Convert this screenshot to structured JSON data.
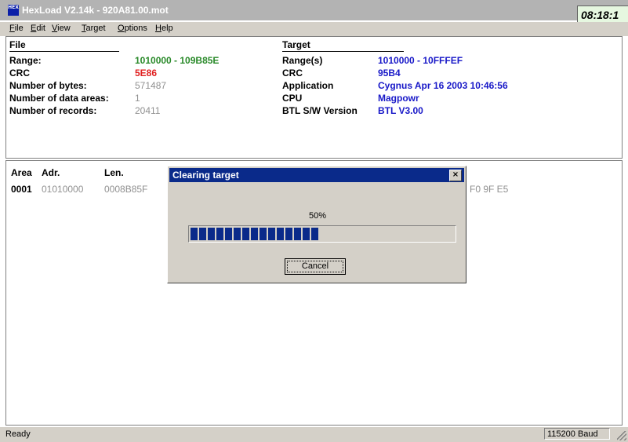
{
  "window": {
    "title": "HexLoad V2.14k - 920A81.00.mot",
    "icon_text": "HEX",
    "clock": "08:18:1"
  },
  "menu": [
    "File",
    "Edit",
    "View",
    "Target",
    "Options",
    "Help"
  ],
  "file_section": {
    "title": "File",
    "rows": [
      {
        "label": "Range:",
        "value": "1010000 - 109B85E"
      },
      {
        "label": "CRC",
        "value": "5E86"
      },
      {
        "label": "Number of bytes:",
        "value": "571487"
      },
      {
        "label": "Number of data areas:",
        "value": "1"
      },
      {
        "label": "Number of records:",
        "value": "20411"
      }
    ]
  },
  "target_section": {
    "title": "Target",
    "rows": [
      {
        "label": "Range(s)",
        "value": "1010000 - 10FFFEF"
      },
      {
        "label": "CRC",
        "value": "95B4"
      },
      {
        "label": "Application",
        "value": "Cygnus Apr 16 2003 10:46:56"
      },
      {
        "label": "CPU",
        "value": "Magpowr"
      },
      {
        "label": "BTL S/W Version",
        "value": "BTL V3.00"
      }
    ]
  },
  "areas_table": {
    "headers": {
      "area": "Area",
      "adr": "Adr.",
      "len": "Len."
    },
    "row": {
      "area": "0001",
      "adr": "01010000",
      "len": "0008B85F",
      "bytes_tail": "F0 9F E5"
    }
  },
  "dialog": {
    "title": "Clearing target",
    "percent_text": "50%",
    "progress": 0.5,
    "cancel_label": "Cancel",
    "close_glyph": "×"
  },
  "status": {
    "left": "Ready",
    "baud": "115200 Baud"
  },
  "colors": {
    "title_bg": "#b3b3b3",
    "dialog_title_bg": "#0a2a8a",
    "green": "#2a8a2a",
    "red": "#e02020",
    "blue": "#1818c8"
  }
}
